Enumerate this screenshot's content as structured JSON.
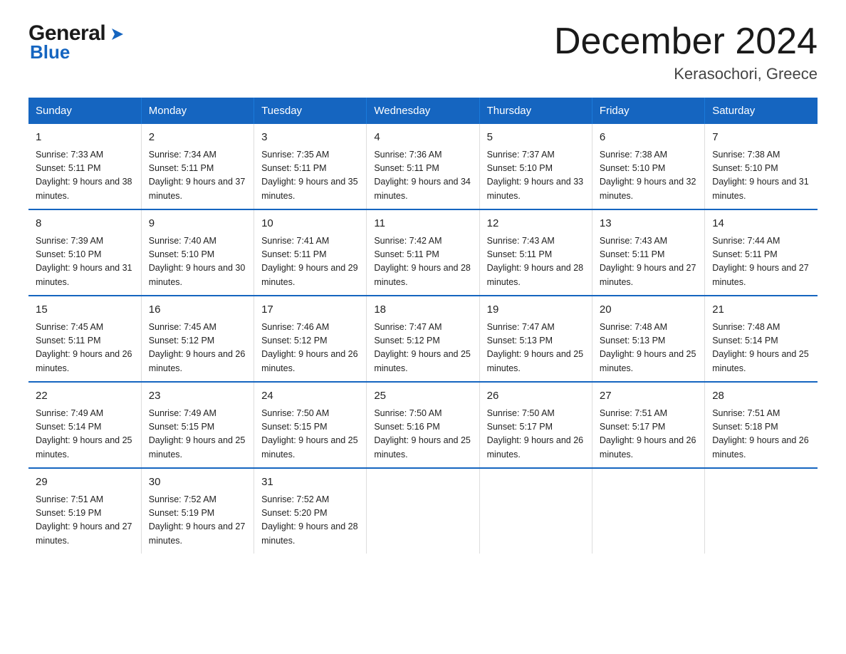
{
  "logo": {
    "general": "General",
    "blue": "Blue",
    "arrow_color": "#1565c0"
  },
  "title": "December 2024",
  "location": "Kerasochori, Greece",
  "days_header": [
    "Sunday",
    "Monday",
    "Tuesday",
    "Wednesday",
    "Thursday",
    "Friday",
    "Saturday"
  ],
  "weeks": [
    [
      {
        "day": "1",
        "sunrise": "Sunrise: 7:33 AM",
        "sunset": "Sunset: 5:11 PM",
        "daylight": "Daylight: 9 hours and 38 minutes."
      },
      {
        "day": "2",
        "sunrise": "Sunrise: 7:34 AM",
        "sunset": "Sunset: 5:11 PM",
        "daylight": "Daylight: 9 hours and 37 minutes."
      },
      {
        "day": "3",
        "sunrise": "Sunrise: 7:35 AM",
        "sunset": "Sunset: 5:11 PM",
        "daylight": "Daylight: 9 hours and 35 minutes."
      },
      {
        "day": "4",
        "sunrise": "Sunrise: 7:36 AM",
        "sunset": "Sunset: 5:11 PM",
        "daylight": "Daylight: 9 hours and 34 minutes."
      },
      {
        "day": "5",
        "sunrise": "Sunrise: 7:37 AM",
        "sunset": "Sunset: 5:10 PM",
        "daylight": "Daylight: 9 hours and 33 minutes."
      },
      {
        "day": "6",
        "sunrise": "Sunrise: 7:38 AM",
        "sunset": "Sunset: 5:10 PM",
        "daylight": "Daylight: 9 hours and 32 minutes."
      },
      {
        "day": "7",
        "sunrise": "Sunrise: 7:38 AM",
        "sunset": "Sunset: 5:10 PM",
        "daylight": "Daylight: 9 hours and 31 minutes."
      }
    ],
    [
      {
        "day": "8",
        "sunrise": "Sunrise: 7:39 AM",
        "sunset": "Sunset: 5:10 PM",
        "daylight": "Daylight: 9 hours and 31 minutes."
      },
      {
        "day": "9",
        "sunrise": "Sunrise: 7:40 AM",
        "sunset": "Sunset: 5:10 PM",
        "daylight": "Daylight: 9 hours and 30 minutes."
      },
      {
        "day": "10",
        "sunrise": "Sunrise: 7:41 AM",
        "sunset": "Sunset: 5:11 PM",
        "daylight": "Daylight: 9 hours and 29 minutes."
      },
      {
        "day": "11",
        "sunrise": "Sunrise: 7:42 AM",
        "sunset": "Sunset: 5:11 PM",
        "daylight": "Daylight: 9 hours and 28 minutes."
      },
      {
        "day": "12",
        "sunrise": "Sunrise: 7:43 AM",
        "sunset": "Sunset: 5:11 PM",
        "daylight": "Daylight: 9 hours and 28 minutes."
      },
      {
        "day": "13",
        "sunrise": "Sunrise: 7:43 AM",
        "sunset": "Sunset: 5:11 PM",
        "daylight": "Daylight: 9 hours and 27 minutes."
      },
      {
        "day": "14",
        "sunrise": "Sunrise: 7:44 AM",
        "sunset": "Sunset: 5:11 PM",
        "daylight": "Daylight: 9 hours and 27 minutes."
      }
    ],
    [
      {
        "day": "15",
        "sunrise": "Sunrise: 7:45 AM",
        "sunset": "Sunset: 5:11 PM",
        "daylight": "Daylight: 9 hours and 26 minutes."
      },
      {
        "day": "16",
        "sunrise": "Sunrise: 7:45 AM",
        "sunset": "Sunset: 5:12 PM",
        "daylight": "Daylight: 9 hours and 26 minutes."
      },
      {
        "day": "17",
        "sunrise": "Sunrise: 7:46 AM",
        "sunset": "Sunset: 5:12 PM",
        "daylight": "Daylight: 9 hours and 26 minutes."
      },
      {
        "day": "18",
        "sunrise": "Sunrise: 7:47 AM",
        "sunset": "Sunset: 5:12 PM",
        "daylight": "Daylight: 9 hours and 25 minutes."
      },
      {
        "day": "19",
        "sunrise": "Sunrise: 7:47 AM",
        "sunset": "Sunset: 5:13 PM",
        "daylight": "Daylight: 9 hours and 25 minutes."
      },
      {
        "day": "20",
        "sunrise": "Sunrise: 7:48 AM",
        "sunset": "Sunset: 5:13 PM",
        "daylight": "Daylight: 9 hours and 25 minutes."
      },
      {
        "day": "21",
        "sunrise": "Sunrise: 7:48 AM",
        "sunset": "Sunset: 5:14 PM",
        "daylight": "Daylight: 9 hours and 25 minutes."
      }
    ],
    [
      {
        "day": "22",
        "sunrise": "Sunrise: 7:49 AM",
        "sunset": "Sunset: 5:14 PM",
        "daylight": "Daylight: 9 hours and 25 minutes."
      },
      {
        "day": "23",
        "sunrise": "Sunrise: 7:49 AM",
        "sunset": "Sunset: 5:15 PM",
        "daylight": "Daylight: 9 hours and 25 minutes."
      },
      {
        "day": "24",
        "sunrise": "Sunrise: 7:50 AM",
        "sunset": "Sunset: 5:15 PM",
        "daylight": "Daylight: 9 hours and 25 minutes."
      },
      {
        "day": "25",
        "sunrise": "Sunrise: 7:50 AM",
        "sunset": "Sunset: 5:16 PM",
        "daylight": "Daylight: 9 hours and 25 minutes."
      },
      {
        "day": "26",
        "sunrise": "Sunrise: 7:50 AM",
        "sunset": "Sunset: 5:17 PM",
        "daylight": "Daylight: 9 hours and 26 minutes."
      },
      {
        "day": "27",
        "sunrise": "Sunrise: 7:51 AM",
        "sunset": "Sunset: 5:17 PM",
        "daylight": "Daylight: 9 hours and 26 minutes."
      },
      {
        "day": "28",
        "sunrise": "Sunrise: 7:51 AM",
        "sunset": "Sunset: 5:18 PM",
        "daylight": "Daylight: 9 hours and 26 minutes."
      }
    ],
    [
      {
        "day": "29",
        "sunrise": "Sunrise: 7:51 AM",
        "sunset": "Sunset: 5:19 PM",
        "daylight": "Daylight: 9 hours and 27 minutes."
      },
      {
        "day": "30",
        "sunrise": "Sunrise: 7:52 AM",
        "sunset": "Sunset: 5:19 PM",
        "daylight": "Daylight: 9 hours and 27 minutes."
      },
      {
        "day": "31",
        "sunrise": "Sunrise: 7:52 AM",
        "sunset": "Sunset: 5:20 PM",
        "daylight": "Daylight: 9 hours and 28 minutes."
      },
      {
        "day": "",
        "sunrise": "",
        "sunset": "",
        "daylight": ""
      },
      {
        "day": "",
        "sunrise": "",
        "sunset": "",
        "daylight": ""
      },
      {
        "day": "",
        "sunrise": "",
        "sunset": "",
        "daylight": ""
      },
      {
        "day": "",
        "sunrise": "",
        "sunset": "",
        "daylight": ""
      }
    ]
  ]
}
